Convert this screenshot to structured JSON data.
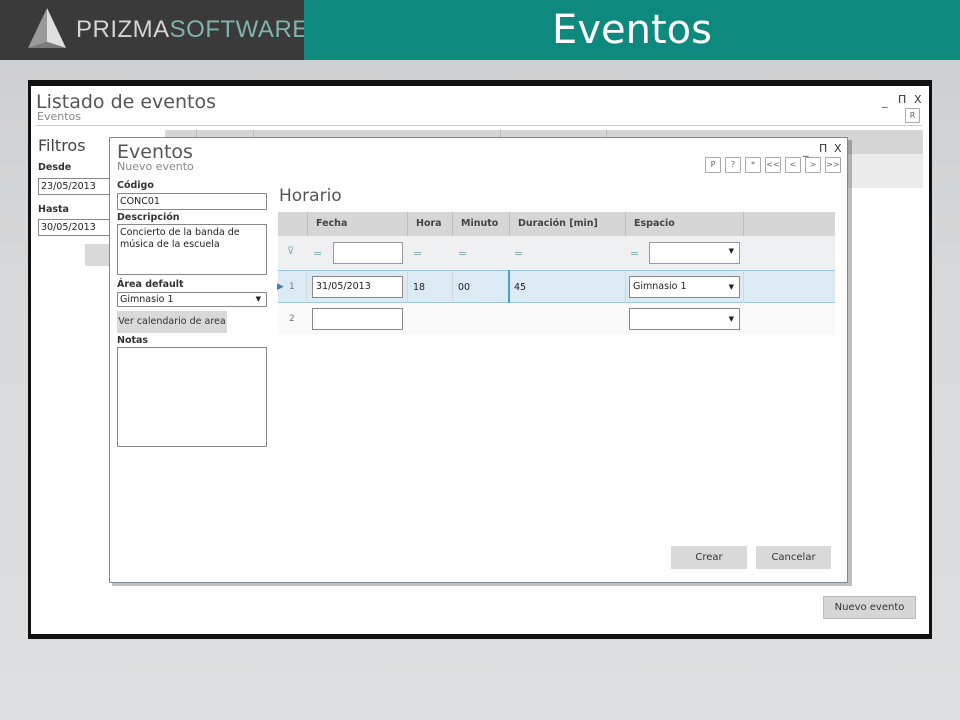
{
  "slide": {
    "title": "Eventos",
    "logo_part1": "PRIZMA",
    "logo_part2": "SOFTWARE"
  },
  "outer_window": {
    "title": "Listado de eventos",
    "subtitle": "Eventos",
    "controls": {
      "minimize": "_",
      "maximize": "П",
      "close": "X",
      "r_button": "R"
    },
    "filters": {
      "title": "Filtros",
      "desde_label": "Desde",
      "desde_value": "23/05/2013",
      "hasta_label": "Hasta",
      "hasta_value": "30/05/2013"
    },
    "new_event_button": "Nuevo evento"
  },
  "modal": {
    "title": "Eventos",
    "subtitle": "Nuevo evento",
    "controls": {
      "minimize": "_",
      "maximize": "П",
      "close": "X"
    },
    "nav_buttons": [
      "P",
      "?",
      "*",
      "<<",
      "<",
      ">",
      ">>"
    ],
    "form": {
      "codigo_label": "Código",
      "codigo_value": "CONC01",
      "descripcion_label": "Descripción",
      "descripcion_value": "Concierto de la banda de música de la escuela",
      "area_label": "Área default",
      "area_value": "Gimnasio 1",
      "ver_calendario_button": "Ver calendario de area",
      "notas_label": "Notas",
      "notas_value": ""
    },
    "horario": {
      "title": "Horario",
      "columns": [
        "Fecha",
        "Hora",
        "Minuto",
        "Duración [min]",
        "Espacio"
      ],
      "filter_operator": "=",
      "rows": [
        {
          "num": "1",
          "fecha": "31/05/2013",
          "hora": "18",
          "minuto": "00",
          "duracion": "45",
          "espacio": "Gimnasio 1"
        },
        {
          "num": "2",
          "fecha": "",
          "hora": "",
          "minuto": "",
          "duracion": "",
          "espacio": ""
        }
      ]
    },
    "crear_button": "Crear",
    "cancelar_button": "Cancelar"
  },
  "colors": {
    "header_teal": "#0d8a7d",
    "logo_bg": "#3a3a3a",
    "selected_row": "#dbeaf3"
  }
}
